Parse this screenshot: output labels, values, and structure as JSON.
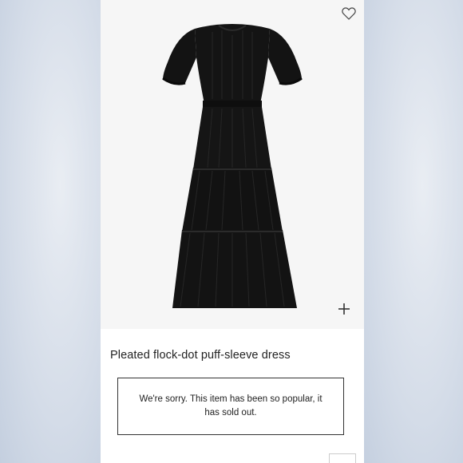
{
  "product": {
    "title": "Pleated flock-dot puff-sleeve dress",
    "availability_message": "We're sorry. This item has been so popular, it has sold out."
  },
  "icons": {
    "wishlist": "heart-outline-icon",
    "zoom": "plus-icon"
  },
  "colors": {
    "dress": "#111111",
    "card_background": "#ffffff",
    "image_background": "#f6f6f6"
  }
}
